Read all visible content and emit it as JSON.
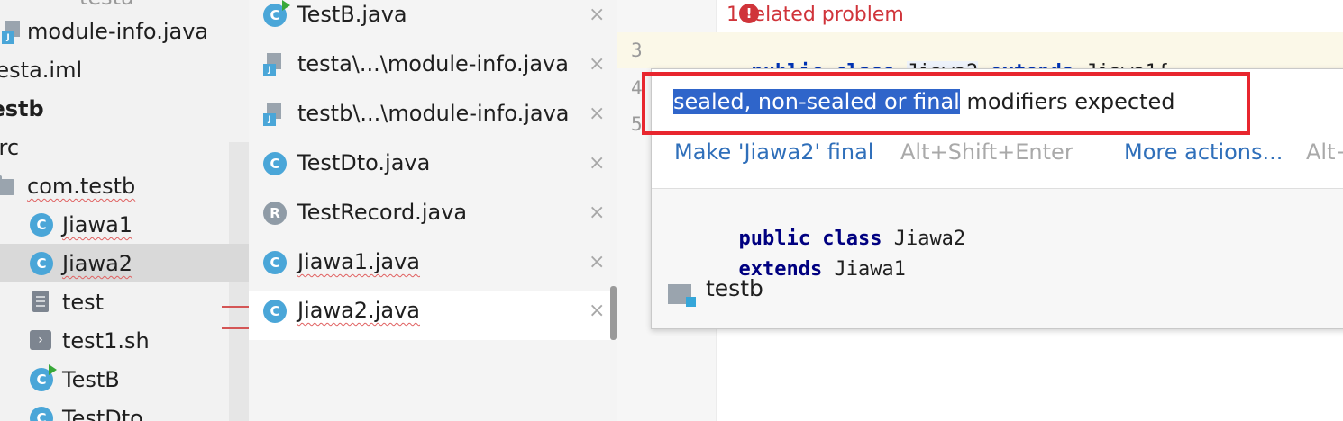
{
  "project_tree": {
    "items": [
      {
        "label": "testa"
      },
      {
        "label": "module-info.java"
      },
      {
        "label": "testa.iml"
      },
      {
        "label": "testb"
      },
      {
        "label": "src"
      },
      {
        "label": "com.testb"
      },
      {
        "label": "Jiawa1"
      },
      {
        "label": "Jiawa2"
      },
      {
        "label": "test"
      },
      {
        "label": "test1.sh"
      },
      {
        "label": "TestB"
      },
      {
        "label": "TestDto"
      }
    ]
  },
  "editor_tabs": [
    {
      "label": "TestB.java",
      "icon": "class-run-icon"
    },
    {
      "label": "testa\\...\\module-info.java",
      "icon": "java-file-icon"
    },
    {
      "label": "testb\\...\\module-info.java",
      "icon": "java-file-icon"
    },
    {
      "label": "TestDto.java",
      "icon": "class-icon"
    },
    {
      "label": "TestRecord.java",
      "icon": "record-icon"
    },
    {
      "label": "Jiawa1.java",
      "icon": "class-icon"
    },
    {
      "label": "Jiawa2.java",
      "icon": "class-icon",
      "active": true
    }
  ],
  "close_glyph": "×",
  "class_glyph": "C",
  "record_glyph": "R",
  "shell_glyph": "›",
  "java_glyph": "J",
  "editor": {
    "related_problem": "1 related problem",
    "lines": [
      {
        "number": "3"
      },
      {
        "number": "4"
      },
      {
        "number": "5"
      }
    ],
    "code_line3": {
      "kw1": "public",
      "kw2": "class",
      "name": "Jiawa2",
      "kw3": "extends",
      "rest": "Jiawa1{"
    }
  },
  "popup": {
    "error_highlight": "sealed, non-sealed or final",
    "error_rest": " modifiers expected",
    "fix_action": "Make 'Jiawa2' final",
    "fix_shortcut": "Alt+Shift+Enter",
    "more_actions": "More actions...",
    "more_shortcut": "Alt+",
    "doc": {
      "kw1": "public",
      "kw2": "class",
      "name": "Jiawa2",
      "kw3": "extends",
      "parent": "Jiawa1",
      "package": "testb"
    }
  },
  "colors": {
    "highlight": "#2f65ca",
    "error_red": "#e8262e",
    "keyword": "#0033b3",
    "link": "#2f6fba"
  }
}
